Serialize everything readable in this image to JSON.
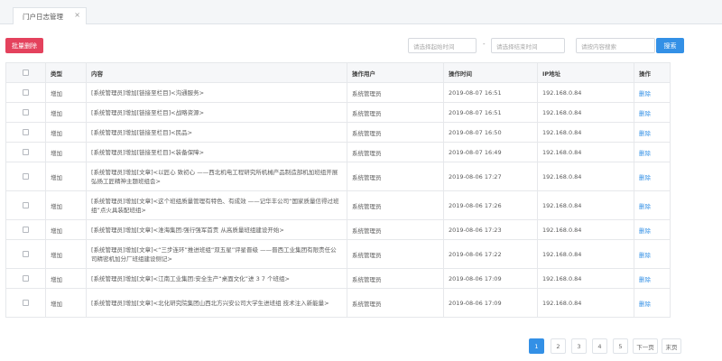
{
  "tab": {
    "label": "门户日志管理",
    "close": "×"
  },
  "toolbar": {
    "batch_delete": "批量删除",
    "start_placeholder": "请选择起始时间",
    "separator": "-",
    "end_placeholder": "请选择结束时间",
    "search_placeholder": "请按内容搜索",
    "search_button": "搜索"
  },
  "table": {
    "headers": {
      "type": "类型",
      "content": "内容",
      "user": "操作用户",
      "time": "操作时间",
      "ip": "IP地址",
      "action": "操作"
    },
    "rows": [
      {
        "type": "增加",
        "content": "[系统管理员]增加[链接至栏目]<沟通服务>",
        "user": "系统管理员",
        "time": "2019-08-07 16:51",
        "ip": "192.168.0.84",
        "action": "删除"
      },
      {
        "type": "增加",
        "content": "[系统管理员]增加[链接至栏目]<战略资源>",
        "user": "系统管理员",
        "time": "2019-08-07 16:51",
        "ip": "192.168.0.84",
        "action": "删除"
      },
      {
        "type": "增加",
        "content": "[系统管理员]增加[链接至栏目]<民品>",
        "user": "系统管理员",
        "time": "2019-08-07 16:50",
        "ip": "192.168.0.84",
        "action": "删除"
      },
      {
        "type": "增加",
        "content": "[系统管理员]增加[链接至栏目]<装备保障>",
        "user": "系统管理员",
        "time": "2019-08-07 16:49",
        "ip": "192.168.0.84",
        "action": "删除"
      },
      {
        "type": "增加",
        "content": "[系统管理员]增加[文章]<以匠心 致初心 ——西北机电工程研究所机械产品制造部机加班组开展弘扬工匠精神主题班组会>",
        "user": "系统管理员",
        "time": "2019-08-06 17:27",
        "ip": "192.168.0.84",
        "action": "删除"
      },
      {
        "type": "增加",
        "content": "[系统管理员]增加[文章]<这个班组质量管理有特色、有成效 ——记华丰公司“国家质量信得过班组”点火具装配班组>",
        "user": "系统管理员",
        "time": "2019-08-06 17:26",
        "ip": "192.168.0.84",
        "action": "删除"
      },
      {
        "type": "增加",
        "content": "[系统管理员]增加[文章]<淮海集团:强行强军首责 从高质量班组建设开始>",
        "user": "系统管理员",
        "time": "2019-08-06 17:23",
        "ip": "192.168.0.84",
        "action": "删除"
      },
      {
        "type": "增加",
        "content": "[系统管理员]增加[文章]<“三步连环”推进班组“双五星”评星晋级 ——晋西工业集团有限责任公司精密机加分厂班组建设侧记>",
        "user": "系统管理员",
        "time": "2019-08-06 17:22",
        "ip": "192.168.0.84",
        "action": "删除"
      },
      {
        "type": "增加",
        "content": "[系统管理员]增加[文章]<江南工业集团:安全生产“桌面文化”进 3 7 个班组>",
        "user": "系统管理员",
        "time": "2019-08-06 17:09",
        "ip": "192.168.0.84",
        "action": "删除"
      },
      {
        "type": "增加",
        "content": "[系统管理员]增加[文章]<北化研究院集团山西北方兴安公司大学生进班组 技术注入新能量>",
        "user": "系统管理员",
        "time": "2019-08-06 17:09",
        "ip": "192.168.0.84",
        "action": "删除"
      }
    ]
  },
  "pagination": {
    "pages": [
      "1",
      "2",
      "3",
      "4",
      "5"
    ],
    "current": "1",
    "next": "下一页",
    "last": "末页"
  }
}
